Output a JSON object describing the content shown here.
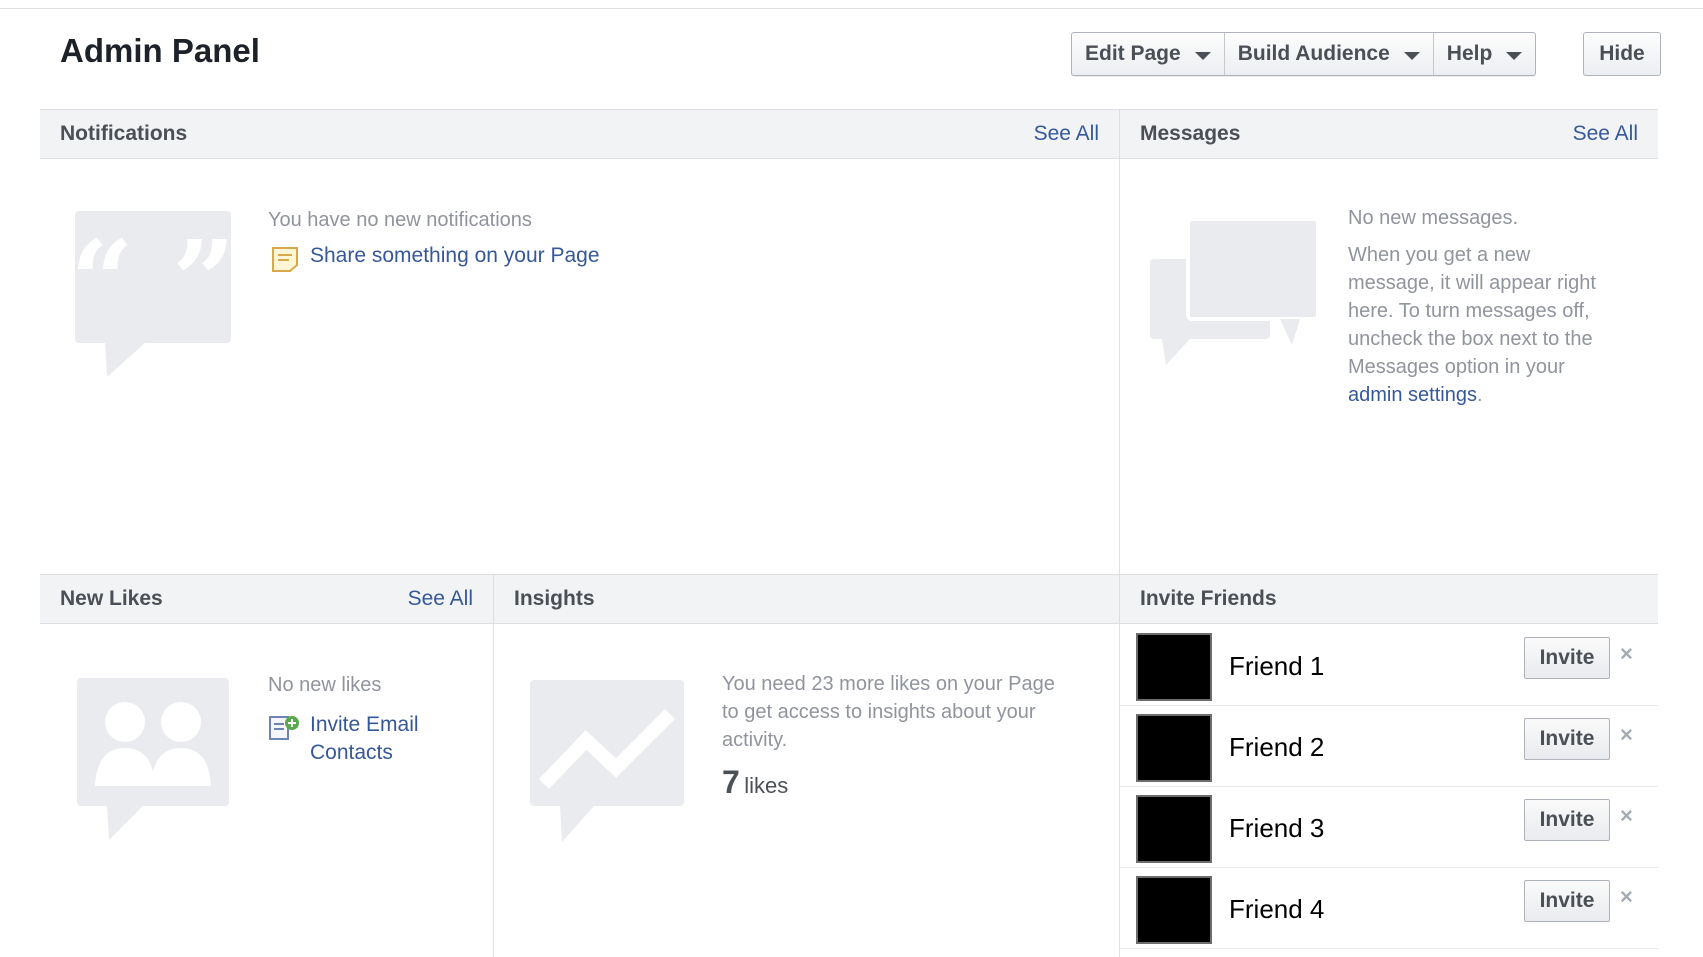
{
  "header": {
    "title": "Admin Panel",
    "buttons": [
      {
        "label": "Edit Page"
      },
      {
        "label": "Build Audience"
      },
      {
        "label": "Help"
      }
    ],
    "hide_label": "Hide"
  },
  "notifications": {
    "title": "Notifications",
    "see_all": "See All",
    "empty_text": "You have no new notifications",
    "share_link": "Share something on your Page"
  },
  "messages": {
    "title": "Messages",
    "see_all": "See All",
    "empty_text": "No new messages.",
    "body_lines": [
      "When you get a new",
      "message, it will appear right",
      "here. To turn messages off,",
      "uncheck the box next to the",
      "Messages option in your"
    ],
    "settings_link": "admin settings",
    "period": "."
  },
  "new_likes": {
    "title": "New Likes",
    "see_all": "See All",
    "empty_text": "No new likes",
    "invite_line1": "Invite Email",
    "invite_line2": "Contacts"
  },
  "insights": {
    "title": "Insights",
    "body_lines": [
      "You need 23 more likes on your Page",
      "to get access to insights about your",
      "activity."
    ],
    "likes_count": "7",
    "likes_label": "likes"
  },
  "invite_friends": {
    "title": "Invite Friends",
    "invite_label": "Invite",
    "remove_glyph": "×",
    "friends": [
      {
        "name": "Friend 1"
      },
      {
        "name": "Friend 2"
      },
      {
        "name": "Friend 3"
      },
      {
        "name": "Friend 4"
      }
    ]
  },
  "colors": {
    "link": "#365899",
    "muted_text": "#90949c",
    "header_bg": "#f2f3f5",
    "icon_gray": "#e9ebee"
  }
}
